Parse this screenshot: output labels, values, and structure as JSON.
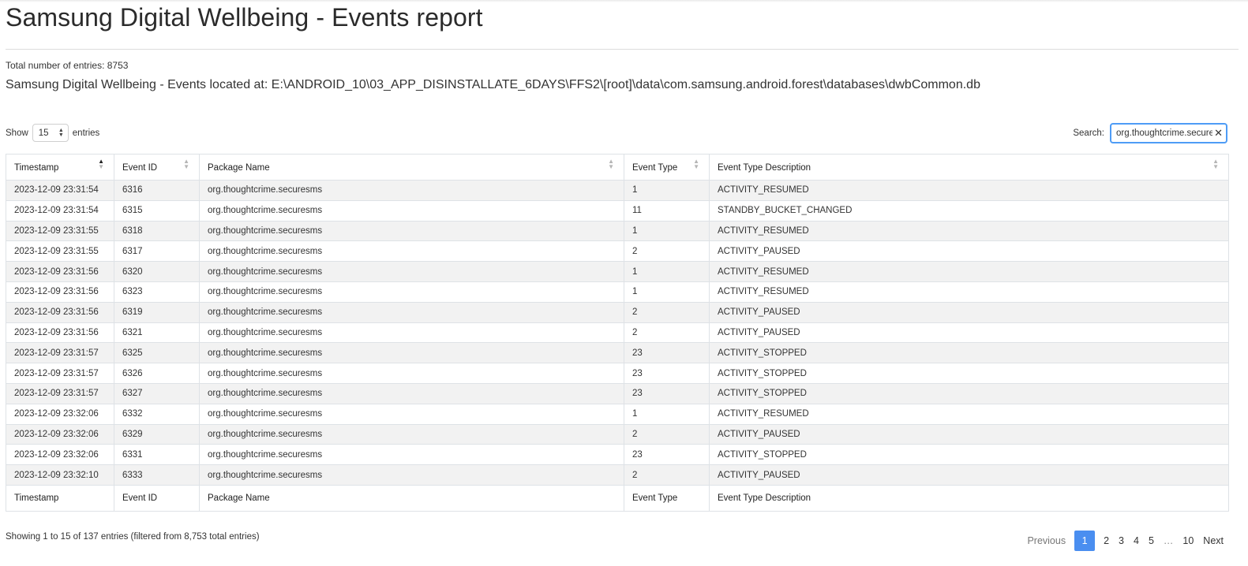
{
  "header": {
    "title": "Samsung Digital Wellbeing - Events report",
    "total_entries": "Total number of entries: 8753",
    "location": "Samsung Digital Wellbeing - Events located at: E:\\ANDROID_10\\03_APP_DISINSTALLATE_6DAYS\\FFS2\\[root]\\data\\com.samsung.android.forest\\databases\\dwbCommon.db"
  },
  "length": {
    "show_label": "Show",
    "value": "15",
    "entries_label": "entries"
  },
  "search": {
    "label": "Search:",
    "value": "org.thoughtcrime.secure"
  },
  "columns": [
    "Timestamp",
    "Event ID",
    "Package Name",
    "Event Type",
    "Event Type Description"
  ],
  "rows": [
    [
      "2023-12-09 23:31:54",
      "6316",
      "org.thoughtcrime.securesms",
      "1",
      "ACTIVITY_RESUMED"
    ],
    [
      "2023-12-09 23:31:54",
      "6315",
      "org.thoughtcrime.securesms",
      "11",
      "STANDBY_BUCKET_CHANGED"
    ],
    [
      "2023-12-09 23:31:55",
      "6318",
      "org.thoughtcrime.securesms",
      "1",
      "ACTIVITY_RESUMED"
    ],
    [
      "2023-12-09 23:31:55",
      "6317",
      "org.thoughtcrime.securesms",
      "2",
      "ACTIVITY_PAUSED"
    ],
    [
      "2023-12-09 23:31:56",
      "6320",
      "org.thoughtcrime.securesms",
      "1",
      "ACTIVITY_RESUMED"
    ],
    [
      "2023-12-09 23:31:56",
      "6323",
      "org.thoughtcrime.securesms",
      "1",
      "ACTIVITY_RESUMED"
    ],
    [
      "2023-12-09 23:31:56",
      "6319",
      "org.thoughtcrime.securesms",
      "2",
      "ACTIVITY_PAUSED"
    ],
    [
      "2023-12-09 23:31:56",
      "6321",
      "org.thoughtcrime.securesms",
      "2",
      "ACTIVITY_PAUSED"
    ],
    [
      "2023-12-09 23:31:57",
      "6325",
      "org.thoughtcrime.securesms",
      "23",
      "ACTIVITY_STOPPED"
    ],
    [
      "2023-12-09 23:31:57",
      "6326",
      "org.thoughtcrime.securesms",
      "23",
      "ACTIVITY_STOPPED"
    ],
    [
      "2023-12-09 23:31:57",
      "6327",
      "org.thoughtcrime.securesms",
      "23",
      "ACTIVITY_STOPPED"
    ],
    [
      "2023-12-09 23:32:06",
      "6332",
      "org.thoughtcrime.securesms",
      "1",
      "ACTIVITY_RESUMED"
    ],
    [
      "2023-12-09 23:32:06",
      "6329",
      "org.thoughtcrime.securesms",
      "2",
      "ACTIVITY_PAUSED"
    ],
    [
      "2023-12-09 23:32:06",
      "6331",
      "org.thoughtcrime.securesms",
      "23",
      "ACTIVITY_STOPPED"
    ],
    [
      "2023-12-09 23:32:10",
      "6333",
      "org.thoughtcrime.securesms",
      "2",
      "ACTIVITY_PAUSED"
    ]
  ],
  "sort": {
    "column": "Timestamp",
    "direction": "ascending"
  },
  "footer": {
    "info": "Showing 1 to 15 of 137 entries (filtered from 8,753 total entries)"
  },
  "pagination": {
    "previous": "Previous",
    "pages": [
      "1",
      "2",
      "3",
      "4",
      "5"
    ],
    "ellipsis": "…",
    "last": "10",
    "next": "Next",
    "current": "1"
  },
  "colors": {
    "accent": "#4a8ef0",
    "search_border": "#4e9cf6",
    "row_stripe": "#f2f2f2"
  }
}
